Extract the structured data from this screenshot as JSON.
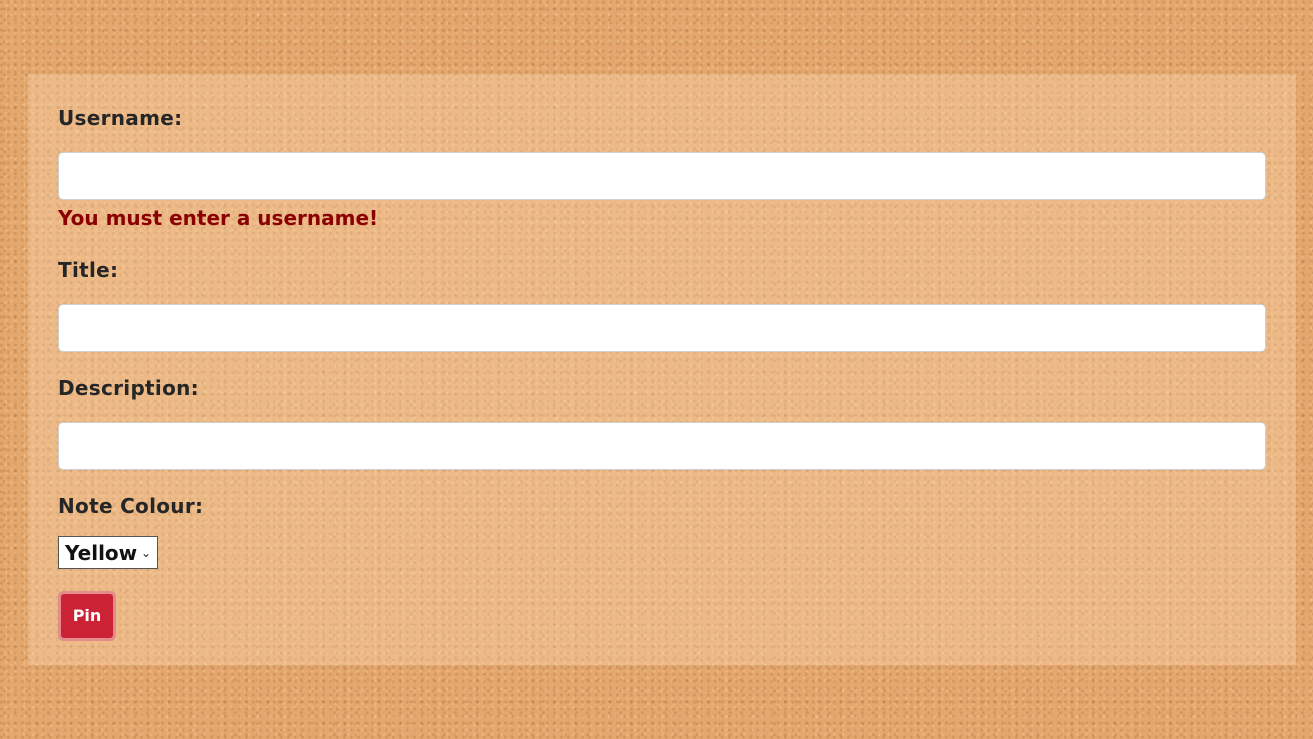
{
  "form": {
    "username": {
      "label": "Username:",
      "value": "",
      "error": "You must enter a username!"
    },
    "title": {
      "label": "Title:",
      "value": ""
    },
    "description": {
      "label": "Description:",
      "value": ""
    },
    "colour": {
      "label": "Note Colour:",
      "selected": "Yellow"
    },
    "submit_label": "Pin"
  },
  "colors": {
    "error_text": "#8b0000",
    "button_bg": "#cc2235",
    "cork_bg": "#e4a76d"
  }
}
